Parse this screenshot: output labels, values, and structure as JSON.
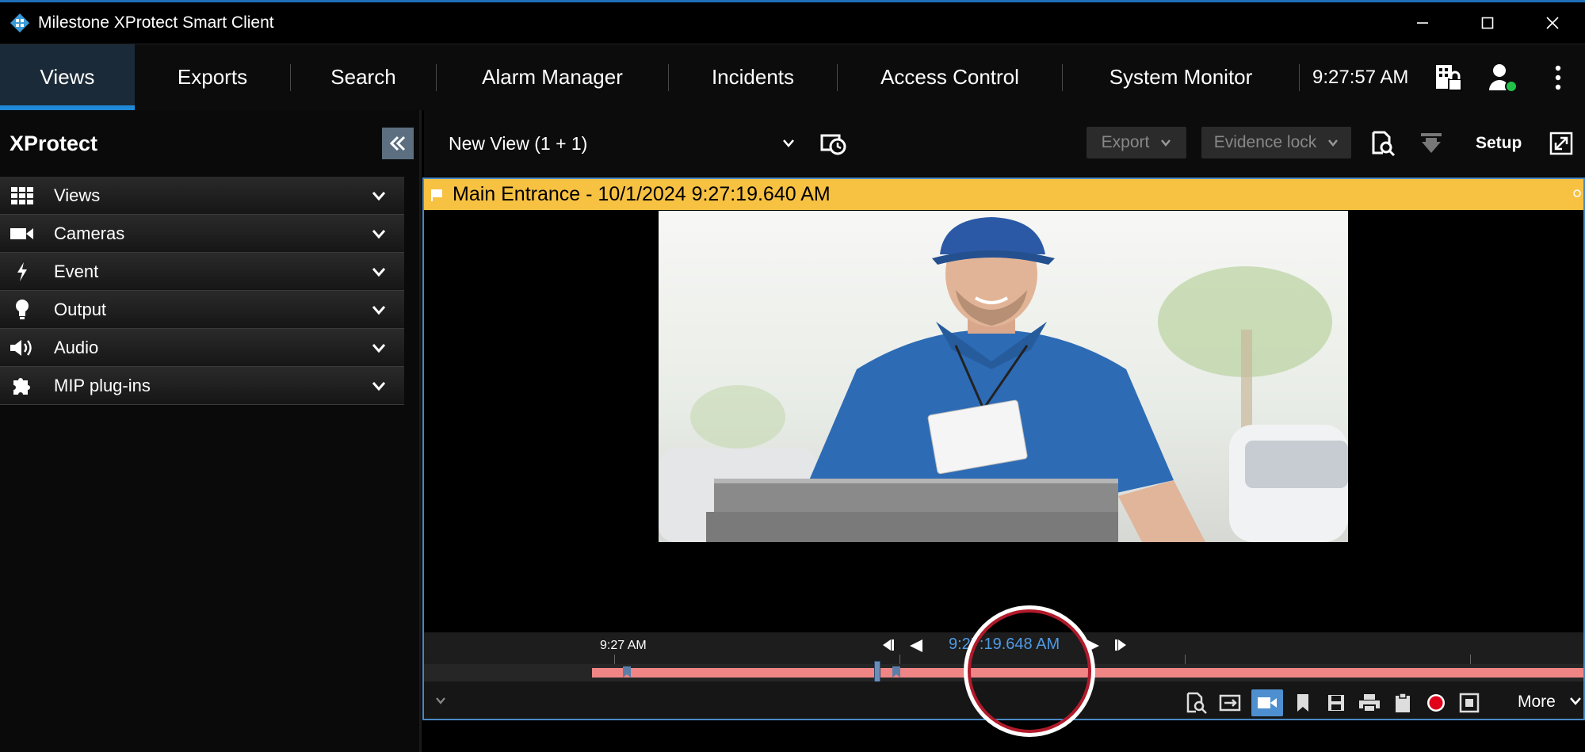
{
  "window": {
    "title": "Milestone XProtect Smart Client",
    "icon": "milestone-logo-icon"
  },
  "nav": {
    "tabs": [
      {
        "label": "Views",
        "active": true
      },
      {
        "label": "Exports",
        "active": false
      },
      {
        "label": "Search",
        "active": false
      },
      {
        "label": "Alarm Manager",
        "active": false
      },
      {
        "label": "Incidents",
        "active": false
      },
      {
        "label": "Access Control",
        "active": false
      },
      {
        "label": "System Monitor",
        "active": false
      }
    ],
    "clock": "9:27:57 AM",
    "icons": [
      "building-lock-icon",
      "user-status-icon",
      "more-vertical-icon"
    ]
  },
  "sidebar": {
    "title": "XProtect",
    "items": [
      {
        "label": "Views",
        "icon": "grid-icon"
      },
      {
        "label": "Cameras",
        "icon": "camera-icon"
      },
      {
        "label": "Event",
        "icon": "lightning-icon"
      },
      {
        "label": "Output",
        "icon": "bulb-icon"
      },
      {
        "label": "Audio",
        "icon": "speaker-icon"
      },
      {
        "label": "MIP plug-ins",
        "icon": "puzzle-icon"
      }
    ]
  },
  "viewbar": {
    "view_name": "New View (1 + 1)",
    "export_label": "Export",
    "evidence_lock_label": "Evidence lock",
    "setup_label": "Setup"
  },
  "tile": {
    "title": "Main Entrance - 10/1/2024 9:27:19.640 AM",
    "header_color": "#f7c142"
  },
  "timeline": {
    "tick_label": "9:27 AM",
    "current_time": "9:27:19.648 AM",
    "more_label": "More",
    "accent_color": "#4f9ae6",
    "fill_color": "#f08585"
  }
}
